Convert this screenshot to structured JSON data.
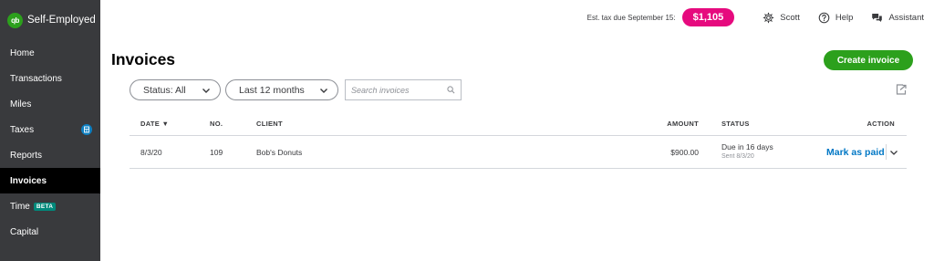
{
  "brand": {
    "logo_text": "qb",
    "name": "Self-Employed"
  },
  "sidebar": {
    "items": [
      {
        "label": "Home"
      },
      {
        "label": "Transactions"
      },
      {
        "label": "Miles"
      },
      {
        "label": "Taxes"
      },
      {
        "label": "Reports"
      },
      {
        "label": "Invoices"
      },
      {
        "label": "Time",
        "badge": "BETA"
      },
      {
        "label": "Capital"
      }
    ],
    "active": "Invoices"
  },
  "header": {
    "est_tax_label": "Est. tax due September 15:",
    "est_tax_amount": "$1,105",
    "user_label": "Scott",
    "help_label": "Help",
    "assistant_label": "Assistant"
  },
  "main": {
    "title": "Invoices",
    "create_button": "Create invoice",
    "filters": {
      "status": "Status: All",
      "range": "Last 12 months",
      "search_placeholder": "Search invoices"
    },
    "table": {
      "headers": {
        "date": "DATE",
        "no": "NO.",
        "client": "CLIENT",
        "amount": "AMOUNT",
        "status": "STATUS",
        "action": "ACTION"
      },
      "rows": [
        {
          "date": "8/3/20",
          "no": "109",
          "client": "Bob's Donuts",
          "amount": "$900.00",
          "status": "Due in 16 days",
          "status_sub": "Sent 8/3/20",
          "action": "Mark as paid"
        }
      ]
    }
  },
  "colors": {
    "sidebar_bg": "#393a3d",
    "active_item_bg": "#000000",
    "accent_green": "#2ca01c",
    "tax_pill": "#e60a7e",
    "link_blue": "#0077c5"
  }
}
